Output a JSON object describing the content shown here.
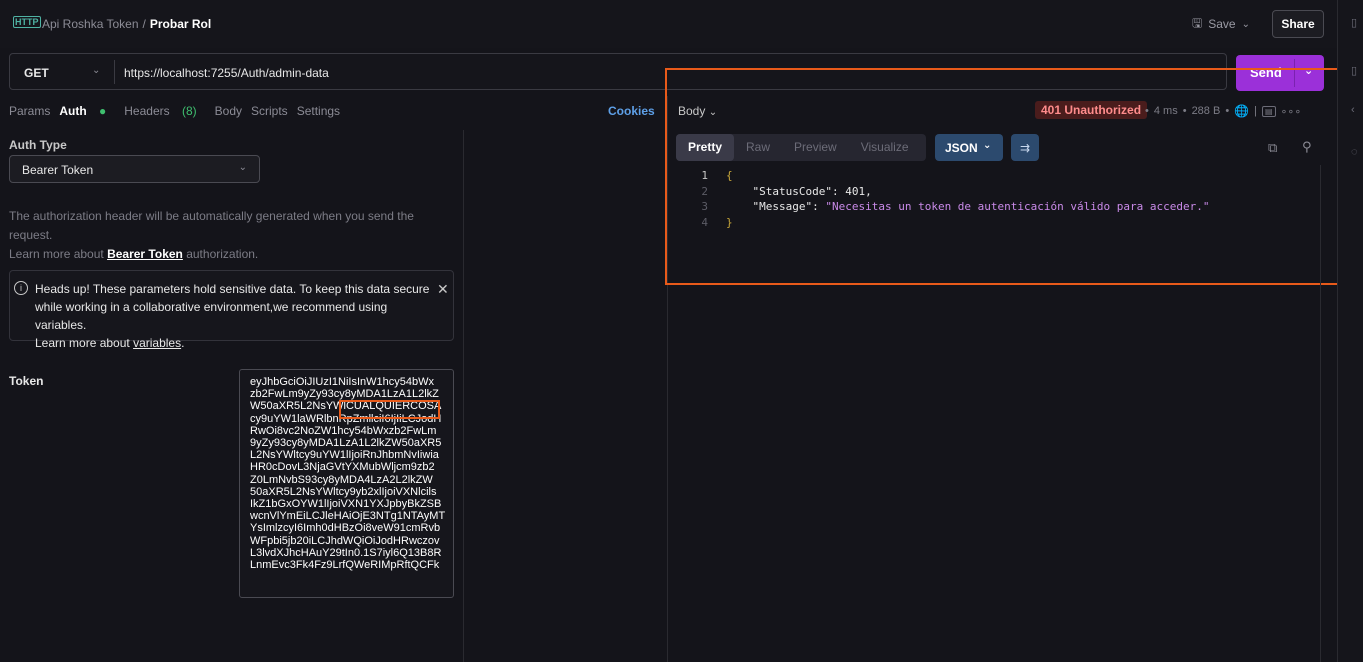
{
  "breadcrumb": {
    "collection": "Api Roshka Token",
    "separator": "/",
    "request": "Probar Rol",
    "icon": "http-icon"
  },
  "toolbar": {
    "save_label": "Save",
    "share_label": "Share"
  },
  "request": {
    "method": "GET",
    "url": "https://localhost:7255/Auth/admin-data",
    "send_label": "Send"
  },
  "tabs": [
    {
      "label": "Params"
    },
    {
      "label": "Auth",
      "indicator": "●"
    },
    {
      "label": "Headers",
      "count": "(8)"
    },
    {
      "label": "Body"
    },
    {
      "label": "Scripts"
    },
    {
      "label": "Settings"
    }
  ],
  "cookies_label": "Cookies",
  "auth": {
    "type_label": "Auth Type",
    "type_value": "Bearer Token",
    "desc_line1": "The authorization header will be automatically generated when you send the request.",
    "desc_line2_pre": "Learn more about ",
    "desc_link": "Bearer Token",
    "desc_line2_post": " authorization.",
    "alert_text": "Heads up! These parameters hold sensitive data. To keep this data secure while working in a collaborative environment,we recommend using variables.",
    "alert_learn_pre": "Learn more about ",
    "alert_learn_link": "variables",
    "alert_learn_post": ".",
    "token_label": "Token",
    "token_value": "eyJhbGciOiJIUzI1NiIsInW1hcy54bWx\nzb2FwLm9yZy93cy8yMDA1LzA1L2lkZ\nW50aXR5L2NsYWlCUALQUIERCOSA\ncy9uYW1laWRlbnRpZmllciI6IjIiLCJodH\nRwOi8vc2NoZW1hcy54bWxzb2FwLm\n9yZy93cy8yMDA1LzA1L2lkZW50aXR5\nL2NsYWltcy9uYW1lIjoiRnJhbmNvIiwia\nHR0cDovL3NjaGVtYXMubWljcm9zb2\nZ0LmNvbS93cy8yMDA4LzA2L2lkZW\n50aXR5L2NsYWltcy9yb2xlIjoiVXNlcils\nIkZ1bGxOYW1lIjoiVXN1YXJpbyBkZSB\nwcnVlYmEiLCJleHAiOjE3NTg1NTAyMT\nYsImlzcyI6Imh0dHBzOi8veW91cmRvb\nWFpbi5jb20iLCJhdWQiOiJodHRwczov\nL3lvdXJhcHAuY29tIn0.1S7iyl6Q13B8R\nLnmEvc3Fk4Fz9LrfQWeRIMpRftQCFk"
  },
  "response": {
    "body_label": "Body",
    "status": "401 Unauthorized",
    "time": "4 ms",
    "size": "288 B",
    "view_tabs": [
      "Pretty",
      "Raw",
      "Preview",
      "Visualize"
    ],
    "format": "JSON",
    "lines": [
      {
        "n": "1",
        "text": "{"
      },
      {
        "n": "2",
        "key": "\"StatusCode\"",
        "value": "401,"
      },
      {
        "n": "3",
        "key": "\"Message\"",
        "value": "\"Necesitas un token de autenticación válido para acceder.\""
      },
      {
        "n": "4",
        "text": "}"
      }
    ]
  },
  "colors": {
    "accent": "#9b30d9",
    "highlight": "#e85a1a",
    "error": "#ff8c8c"
  }
}
